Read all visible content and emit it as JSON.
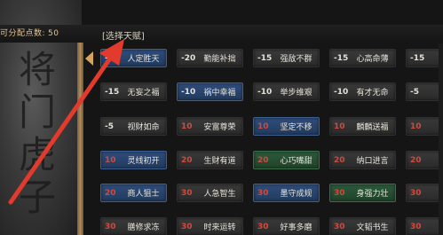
{
  "header": {
    "points_label": "可分配点数:",
    "points_value": "50",
    "panel_title": "[选择天赋]"
  },
  "side_art": {
    "text": "将门虎子"
  },
  "colors": {
    "arrow": "#e23a2c",
    "gold_frame": "#b08c5c",
    "cost_negative": "#e5e0d6",
    "cost_positive": "#d24a3c"
  },
  "talents": [
    [
      {
        "cost": "-20",
        "name": "人定胜天",
        "tint": "blue"
      },
      {
        "cost": "-20",
        "name": "勤能补拙",
        "tint": "gray"
      },
      {
        "cost": "-15",
        "name": "强敌不群",
        "tint": "gray"
      },
      {
        "cost": "-15",
        "name": "心高命薄",
        "tint": "gray"
      },
      {
        "cost": "-15",
        "name": "",
        "tint": "gray"
      }
    ],
    [
      {
        "cost": "-15",
        "name": "无妄之福",
        "tint": "gray"
      },
      {
        "cost": "-10",
        "name": "祸中幸福",
        "tint": "blue"
      },
      {
        "cost": "-10",
        "name": "举步维艰",
        "tint": "gray"
      },
      {
        "cost": "-10",
        "name": "有才无命",
        "tint": "gray"
      },
      {
        "cost": "-5",
        "name": "",
        "tint": "gray"
      }
    ],
    [
      {
        "cost": "-5",
        "name": "视财如命",
        "tint": "gray"
      },
      {
        "cost": "10",
        "name": "安富尊荣",
        "tint": "gray"
      },
      {
        "cost": "10",
        "name": "坚定不移",
        "tint": "blue"
      },
      {
        "cost": "10",
        "name": "麟麟送福",
        "tint": "gray"
      },
      {
        "cost": "10",
        "name": "",
        "tint": "gray"
      }
    ],
    [
      {
        "cost": "10",
        "name": "灵线初开",
        "tint": "blue"
      },
      {
        "cost": "20",
        "name": "生财有道",
        "tint": "gray"
      },
      {
        "cost": "20",
        "name": "心巧嘴甜",
        "tint": "green"
      },
      {
        "cost": "20",
        "name": "纳口进言",
        "tint": "gray"
      },
      {
        "cost": "20",
        "name": "",
        "tint": "gray"
      }
    ],
    [
      {
        "cost": "20",
        "name": "商人狙士",
        "tint": "blue"
      },
      {
        "cost": "30",
        "name": "人急智生",
        "tint": "gray"
      },
      {
        "cost": "30",
        "name": "墨守成规",
        "tint": "blue"
      },
      {
        "cost": "30",
        "name": "身强力壮",
        "tint": "green"
      },
      {
        "cost": "30",
        "name": "",
        "tint": "gray"
      }
    ],
    [
      {
        "cost": "30",
        "name": "膳修求冻",
        "tint": "gray"
      },
      {
        "cost": "30",
        "name": "时来运转",
        "tint": "gray"
      },
      {
        "cost": "30",
        "name": "好事多磨",
        "tint": "gray"
      },
      {
        "cost": "30",
        "name": "文韬书生",
        "tint": "gray"
      },
      {
        "cost": "30",
        "name": "",
        "tint": "gray"
      }
    ]
  ]
}
